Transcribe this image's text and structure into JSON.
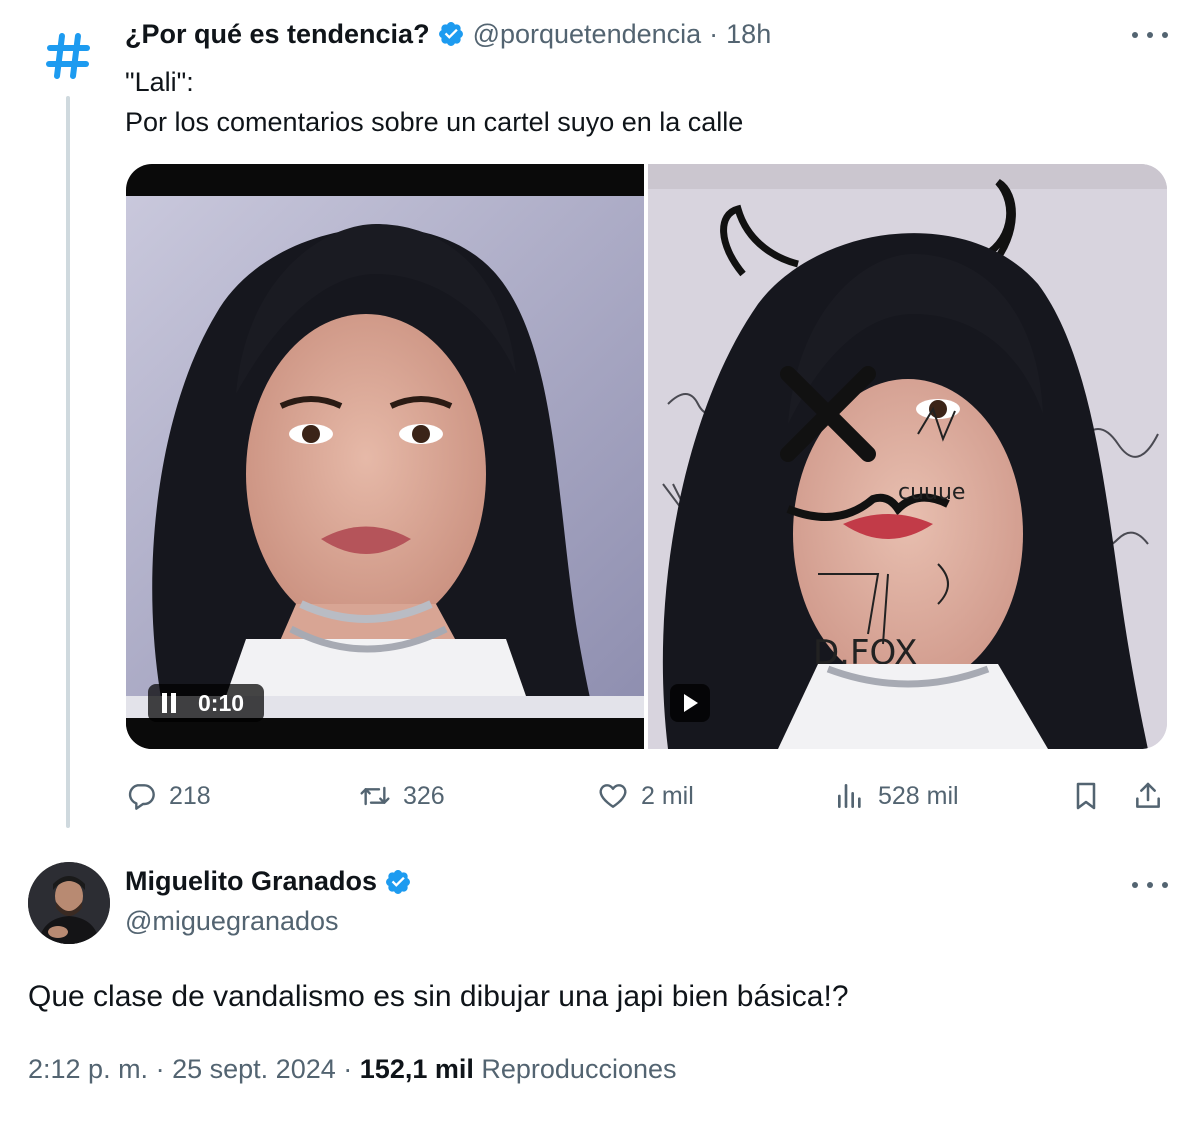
{
  "tweet1": {
    "display_name": "¿Por qué es tendencia?",
    "handle": "@porquetendencia",
    "separator": "·",
    "time": "18h",
    "line1": "\"Lali\":",
    "line2": "Por los comentarios sobre un cartel suyo en la calle",
    "video_time": "0:10",
    "stats": {
      "replies": "218",
      "reposts": "326",
      "likes": "2 mil",
      "views": "528 mil"
    }
  },
  "tweet2": {
    "display_name": "Miguelito Granados",
    "handle": "@miguegranados",
    "text": "Que clase de vandalismo es sin dibujar una japi bien básica!?",
    "time": "2:12 p. m.",
    "sep1": "·",
    "date": "25 sept. 2024",
    "sep2": "·",
    "views_count": "152,1 mil",
    "views_label": "Reproducciones"
  },
  "icons": {
    "verified": "verified-badge-icon",
    "more": "more-dots-icon",
    "reply": "reply-icon",
    "repost": "repost-icon",
    "like": "heart-icon",
    "views": "views-chart-icon",
    "bookmark": "bookmark-icon",
    "share": "share-icon",
    "pause": "pause-icon",
    "play": "play-icon"
  },
  "colors": {
    "text": "#0f1419",
    "secondary": "#536471",
    "verified": "#1d9bf0",
    "hashtag": "#1d9bf0",
    "thread_line": "#cfd9de"
  }
}
